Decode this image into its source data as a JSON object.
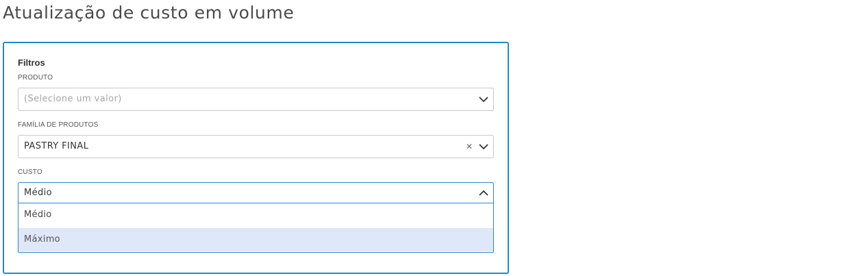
{
  "page": {
    "title": "Atualização de custo em volume"
  },
  "filters": {
    "title": "Filtros",
    "produto": {
      "label": "PRODUTO",
      "placeholder": "(Selecione um valor)"
    },
    "familia": {
      "label": "FAMÍLIA DE PRODUTOS",
      "value": "PASTRY FINAL",
      "clear_icon": "close-icon"
    },
    "custo": {
      "label": "CUSTO",
      "value": "Médio",
      "options": [
        "Médio",
        "Máximo"
      ],
      "highlighted_option": "Máximo"
    }
  },
  "colors": {
    "accent": "#1f8ccc",
    "highlight": "#dfe8f9"
  }
}
